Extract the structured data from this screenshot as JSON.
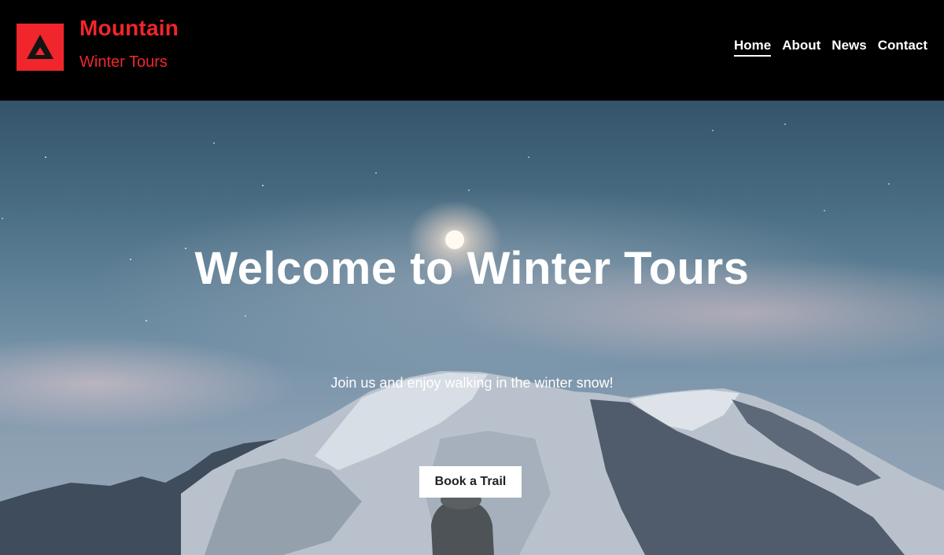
{
  "brand": {
    "logo_icon": "mountain-triangle-icon",
    "title": "Mountain",
    "subtitle": "Winter Tours"
  },
  "nav": {
    "items": [
      {
        "label": "Home",
        "active": true
      },
      {
        "label": "About",
        "active": false
      },
      {
        "label": "News",
        "active": false
      },
      {
        "label": "Contact",
        "active": false
      }
    ]
  },
  "hero": {
    "title": "Welcome to Winter Tours",
    "subtitle": "Join us and enjoy walking in the winter snow!",
    "cta_label": "Book a Trail"
  },
  "colors": {
    "brand_red": "#f0262c",
    "header_bg": "#000000",
    "text_light": "#ffffff"
  }
}
